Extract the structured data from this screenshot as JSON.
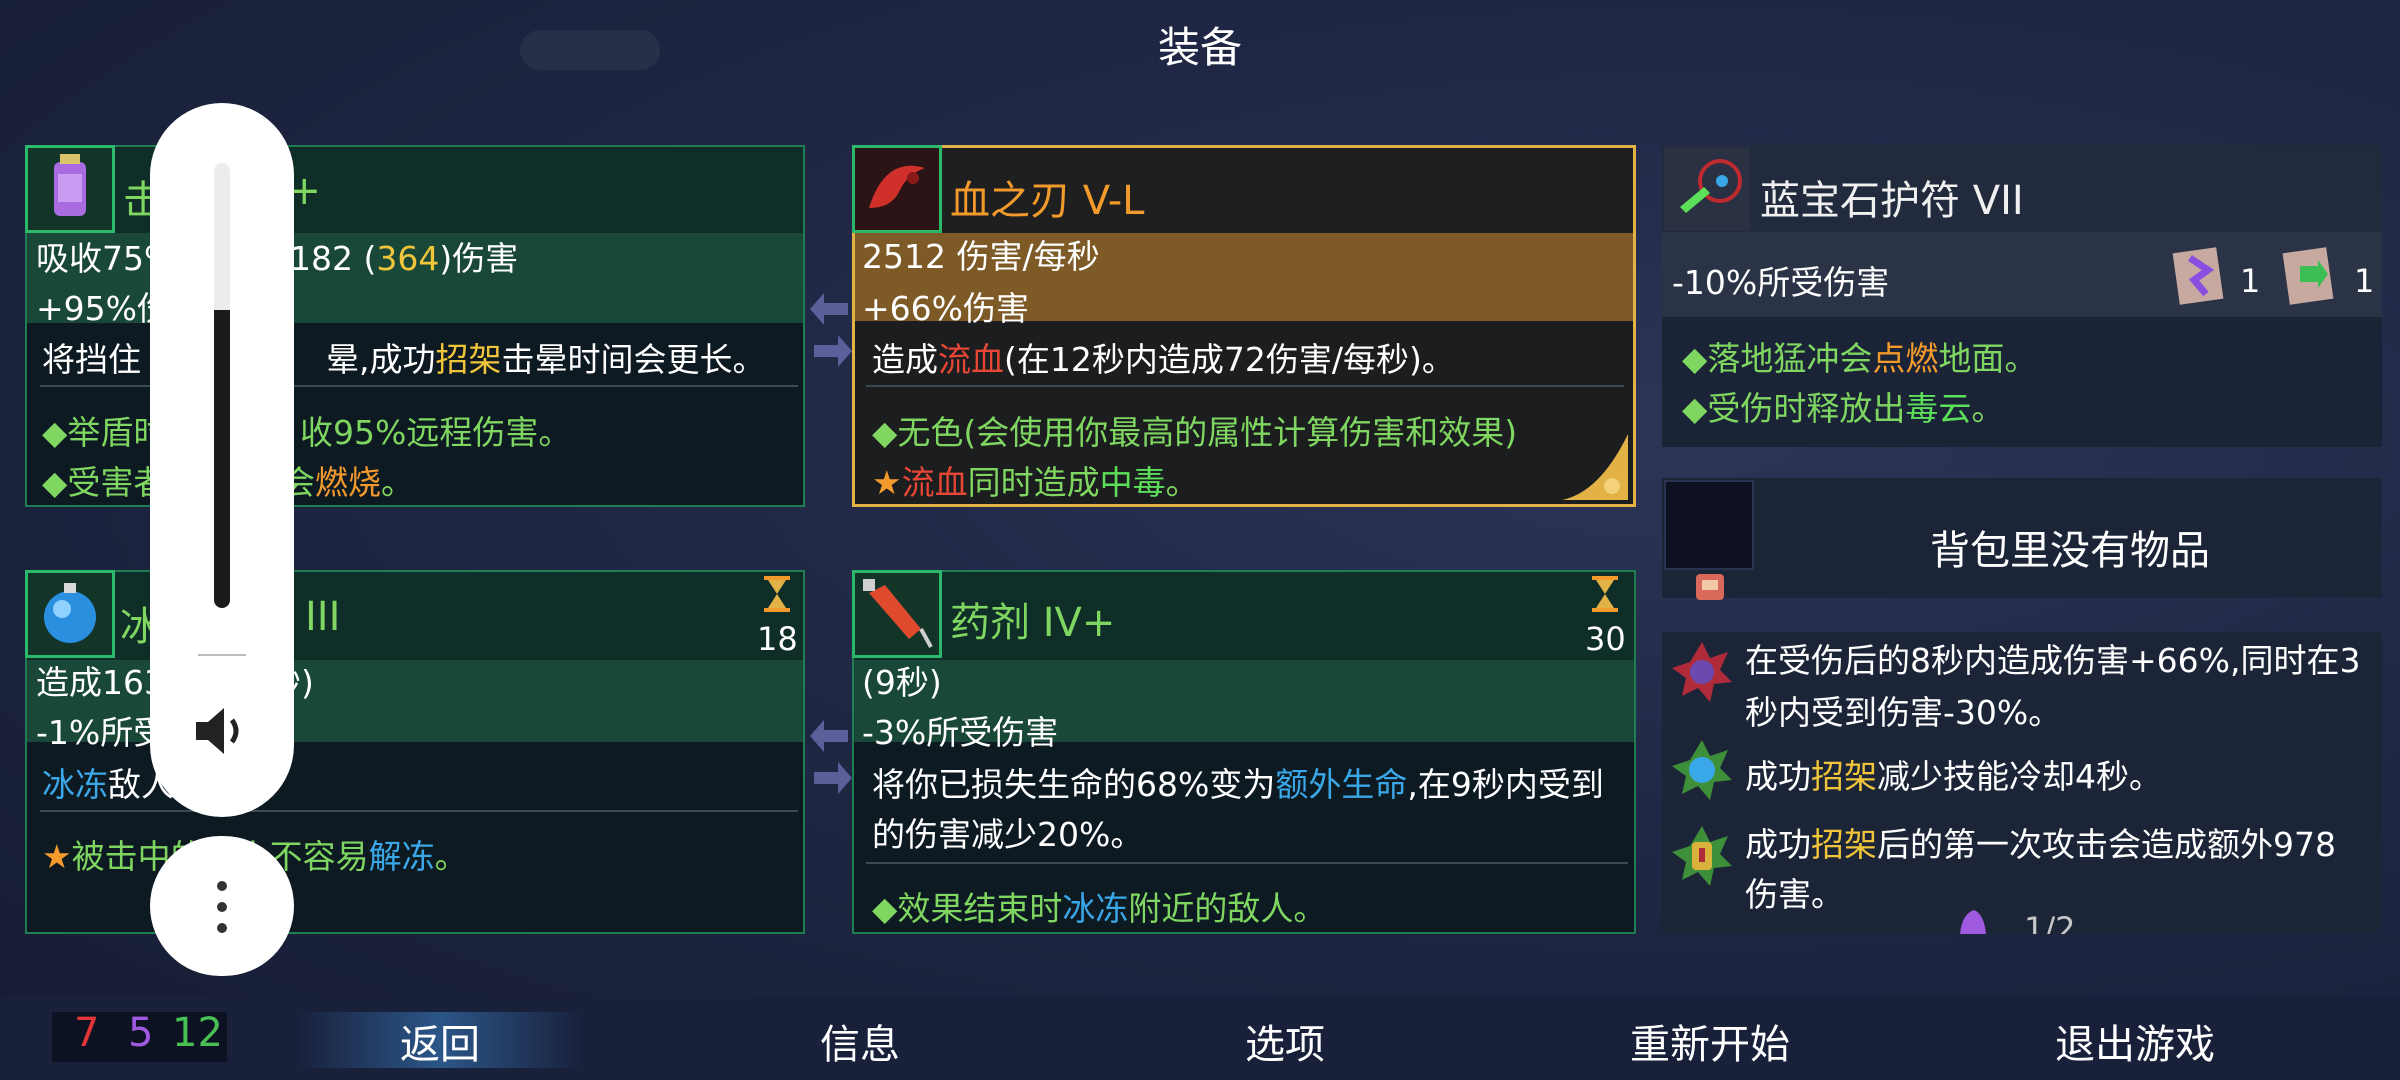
{
  "screen": {
    "title": "装备"
  },
  "weapons": {
    "shield": {
      "name_visible": "击",
      "name_suffix": "7+",
      "absorb_prefix": "吸收75%",
      "absorb_dmg": "182 (",
      "absorb_dmg_high": "364",
      "absorb_dmg_end": ")伤害",
      "stat": "+95%伤",
      "desc_a": "将挡住",
      "desc_b": "晕,成功",
      "desc_keyword": "招架",
      "desc_c": "击晕时间会更长。",
      "effect1_a": "◆举盾时",
      "effect1_b": "收95%远程伤害。",
      "effect2_a": "◆受害者",
      "effect2_b": "会",
      "effect2_keyword": "燃烧",
      "effect2_end": "。"
    },
    "blade": {
      "name": "血之刃 V-L",
      "dps": "2512 伤害/每秒",
      "stat": "+66%伤害",
      "desc_a": "造成",
      "desc_keyword": "流血",
      "desc_b": "(在12秒内造成72伤害/每秒)。",
      "effect1": "◆无色(会使用你最高的属性计算伤害和效果)",
      "effect2_keyword": "流血",
      "effect2_b": "同时造成",
      "effect2_keyword2": "中毒",
      "effect2_end": "。"
    },
    "ice": {
      "name_visible": "冰",
      "name_suffix": "III",
      "cooldown": "18",
      "desc_line1": "造成163",
      "desc_line1_end": "秒)",
      "stat": "-1%所受",
      "effect_keyword": "冰冻",
      "effect_b": "敌人",
      "effect2_a": "被击中的敌人不容易",
      "effect2_keyword": "解冻",
      "effect2_end": "。"
    },
    "potion": {
      "name": "药剂 IV+",
      "cooldown": "30",
      "duration": "(9秒)",
      "stat": "-3%所受伤害",
      "desc_a": "将你已损失生命的68%变为",
      "desc_keyword": "额外生命",
      "desc_b": ",在9秒内受到",
      "desc_line2": "的伤害减少20%。",
      "effect_a": "◆效果结束时",
      "effect_keyword": "冰冻",
      "effect_b": "附近的敌人。"
    }
  },
  "amulet": {
    "name": "蓝宝石护符 VII",
    "stat": "-10%所受伤害",
    "scroll1_count": "1",
    "scroll2_count": "1",
    "effect1_a": "◆落地猛冲会",
    "effect1_keyword": "点燃",
    "effect1_b": "地面。",
    "effect2_a": "◆受伤时释放出",
    "effect2_keyword": "毒云",
    "effect2_b": "。"
  },
  "backpack": {
    "empty_text": "背包里没有物品"
  },
  "mutations": [
    {
      "line1": "在受伤后的8秒内造成伤害+66%,同时在3",
      "line2": "秒内受到伤害-30%。"
    },
    {
      "a": "成功",
      "keyword": "招架",
      "b": "减少技能冷却4秒。"
    },
    {
      "a": "成功",
      "keyword": "招架",
      "b": "后的第一次攻击会造成额外978",
      "line2": "伤害。"
    }
  ],
  "pager": "1/2",
  "stats": {
    "brutality": "7",
    "tactics": "5",
    "survival": "12",
    "colors": {
      "brutality": "#e2353a",
      "tactics": "#a05ae0",
      "survival": "#48c054"
    }
  },
  "menu": {
    "back": "返回",
    "info": "信息",
    "options": "选项",
    "restart": "重新开始",
    "quit": "退出游戏"
  },
  "overlay": {
    "icons": [
      "volume-icon",
      "more-options-icon"
    ],
    "volume_level": 0.67
  }
}
